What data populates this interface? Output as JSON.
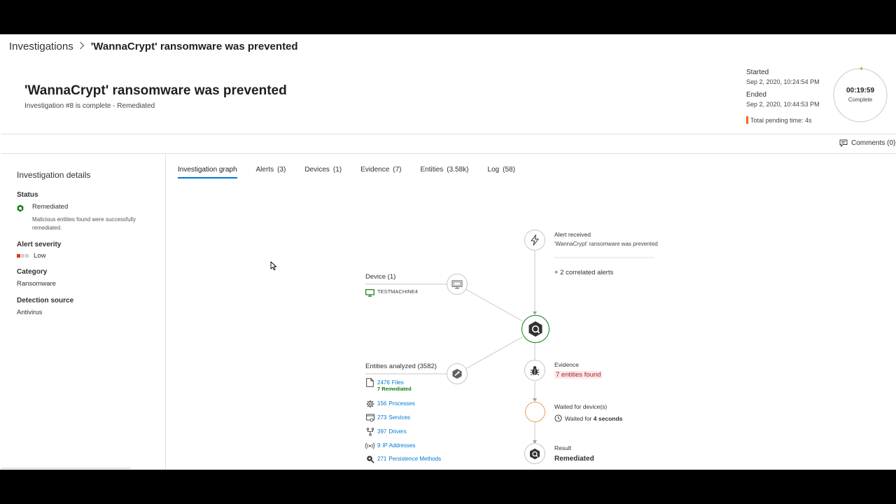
{
  "breadcrumb": {
    "root": "Investigations",
    "separator": ">",
    "current": "'WannaCrypt' ransomware was prevented"
  },
  "header": {
    "title": "'WannaCrypt' ransomware was prevented",
    "subtitle": "Investigation #8 is complete - Remediated",
    "started_label": "Started",
    "started_value": "Sep 2, 2020, 10:24:54 PM",
    "ended_label": "Ended",
    "ended_value": "Sep 2, 2020, 10:44:53 PM",
    "pending_label": "Total pending time: 4s",
    "timer": {
      "time": "00:19:59",
      "status": "Complete"
    }
  },
  "comments": {
    "label": "Comments (0)"
  },
  "sidebar": {
    "title": "Investigation details",
    "status_label": "Status",
    "status_value": "Remediated",
    "status_desc": "Malicious entities found were successfully remediated.",
    "severity_label": "Alert severity",
    "severity_value": "Low",
    "category_label": "Category",
    "category_value": "Ransomware",
    "detection_label": "Detection source",
    "detection_value": "Antivirus"
  },
  "tabs": [
    {
      "label": "Investigation graph",
      "count": ""
    },
    {
      "label": "Alerts",
      "count": "(3)"
    },
    {
      "label": "Devices",
      "count": "(1)"
    },
    {
      "label": "Evidence",
      "count": "(7)"
    },
    {
      "label": "Entities",
      "count": "(3.58k)"
    },
    {
      "label": "Log",
      "count": "(58)"
    }
  ],
  "graph": {
    "alert_received": "Alert received",
    "alert_name": "'WannaCrypt' ransomware was prevented",
    "correlated": "+ 2 correlated alerts",
    "device_label": "Device (1)",
    "device_name": "TESTMACHINE4",
    "entities_label": "Entities analyzed (3582)",
    "entities": [
      {
        "count": "2476",
        "name": "Files",
        "sub": "7 Remediated",
        "icon": "file-icon"
      },
      {
        "count": "156",
        "name": "Processes",
        "icon": "gear-icon"
      },
      {
        "count": "273",
        "name": "Services",
        "icon": "service-icon"
      },
      {
        "count": "397",
        "name": "Drivers",
        "icon": "driver-icon"
      },
      {
        "count": "9",
        "name": "IP Addresses",
        "icon": "broadcast-icon"
      },
      {
        "count": "271",
        "name": "Persistence Methods",
        "icon": "persistence-icon"
      }
    ],
    "evidence_label": "Evidence",
    "evidence_value": "7 entities found",
    "waited_label": "Waited for device(s)",
    "waited_prefix": "Waited for",
    "waited_value": "4 seconds",
    "result_label": "Result",
    "result_value": "Remediated"
  },
  "colors": {
    "accent": "#0078d4",
    "success": "#107c10",
    "warning": "#d83b01",
    "waiting": "#e8a165",
    "pending_bar": "#e8691e"
  }
}
